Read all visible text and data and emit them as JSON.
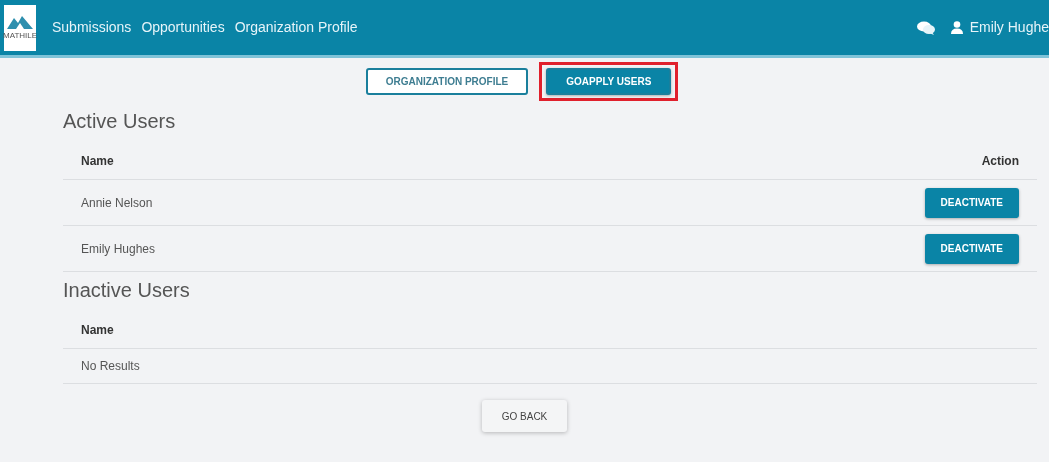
{
  "navbar": {
    "logo_text": "MATHILE",
    "links": [
      "Submissions",
      "Opportunities",
      "Organization Profile"
    ],
    "user_name": "Emily Hughe"
  },
  "tabs": [
    {
      "label": "ORGANIZATION PROFILE",
      "selected": false,
      "highlighted": false
    },
    {
      "label": "GOAPPLY USERS",
      "selected": true,
      "highlighted": true
    }
  ],
  "sections": [
    {
      "title": "Active Users",
      "columns": [
        "Name",
        "Action"
      ],
      "rows": [
        {
          "name": "Annie Nelson",
          "action": "DEACTIVATE"
        },
        {
          "name": "Emily Hughes",
          "action": "DEACTIVATE"
        }
      ]
    },
    {
      "title": "Inactive Users",
      "columns": [
        "Name"
      ],
      "empty_text": "No Results"
    }
  ],
  "back_button": "GO BACK"
}
